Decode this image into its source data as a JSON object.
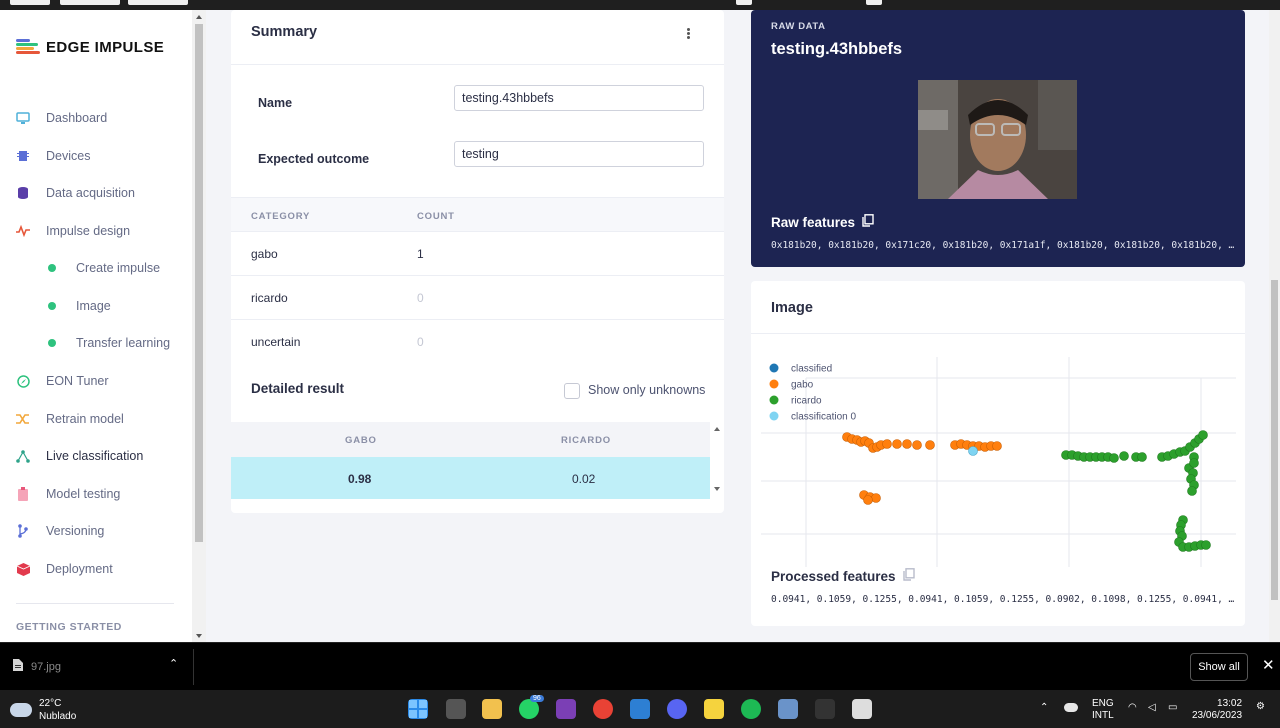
{
  "sidebar": {
    "logo": "EDGE IMPULSE",
    "items": [
      {
        "label": "Dashboard",
        "icon": "monitor-icon",
        "color": "#4fb0d9"
      },
      {
        "label": "Devices",
        "icon": "chip-icon",
        "color": "#5b6fd6"
      },
      {
        "label": "Data acquisition",
        "icon": "database-icon",
        "color": "#5a3ea8"
      },
      {
        "label": "Impulse design",
        "icon": "pulse-icon",
        "color": "#e6573a"
      },
      {
        "label": "Create impulse",
        "icon": "dot-icon"
      },
      {
        "label": "Image",
        "icon": "dot-icon"
      },
      {
        "label": "Transfer learning",
        "icon": "dot-icon"
      },
      {
        "label": "EON Tuner",
        "icon": "compass-icon",
        "color": "#2ec27e"
      },
      {
        "label": "Retrain model",
        "icon": "shuffle-icon",
        "color": "#f2a73b"
      },
      {
        "label": "Live classification",
        "icon": "network-icon",
        "color": "#2ea38a"
      },
      {
        "label": "Model testing",
        "icon": "clipboard-icon",
        "color": "#e8577a"
      },
      {
        "label": "Versioning",
        "icon": "branch-icon",
        "color": "#5b6fd6"
      },
      {
        "label": "Deployment",
        "icon": "cube-icon",
        "color": "#e23a4d"
      }
    ],
    "section": "GETTING STARTED"
  },
  "summary": {
    "title": "Summary",
    "name_label": "Name",
    "name_value": "testing.43hbbefs",
    "outcome_label": "Expected outcome",
    "outcome_value": "testing",
    "columns": [
      "CATEGORY",
      "COUNT"
    ],
    "rows": [
      {
        "category": "gabo",
        "count": "1"
      },
      {
        "category": "ricardo",
        "count": "0"
      },
      {
        "category": "uncertain",
        "count": "0"
      }
    ],
    "detailed_title": "Detailed result",
    "show_unknowns_label": "Show only unknowns",
    "result_columns": [
      "GABO",
      "RICARDO"
    ],
    "result_row": [
      "0.98",
      "0.02"
    ]
  },
  "raw_data": {
    "label": "RAW DATA",
    "title": "testing.43hbbefs",
    "features_label": "Raw features",
    "features": "0x181b20, 0x181b20, 0x171c20, 0x181b20, 0x171a1f, 0x181b20, 0x181b20, 0x181b20, …"
  },
  "image_card": {
    "title": "Image",
    "legend": [
      {
        "name": "classified",
        "color": "#1f77b4"
      },
      {
        "name": "gabo",
        "color": "#ff7f0e"
      },
      {
        "name": "ricardo",
        "color": "#2ca02c"
      },
      {
        "name": "classification 0",
        "color": "#7fd4f2"
      }
    ],
    "processed_label": "Processed features",
    "processed": "0.0941, 0.1059, 0.1255, 0.0941, 0.1059, 0.1255, 0.0902, 0.1098, 0.1255, 0.0941, …"
  },
  "downloads": {
    "file": "97.jpg",
    "show_all": "Show all"
  },
  "taskbar": {
    "temp": "22°C",
    "weather": "Nublado",
    "lang1": "ENG",
    "lang2": "INTL",
    "time": "13:02",
    "date": "23/06/2023",
    "badge_whatsapp": "96"
  }
}
